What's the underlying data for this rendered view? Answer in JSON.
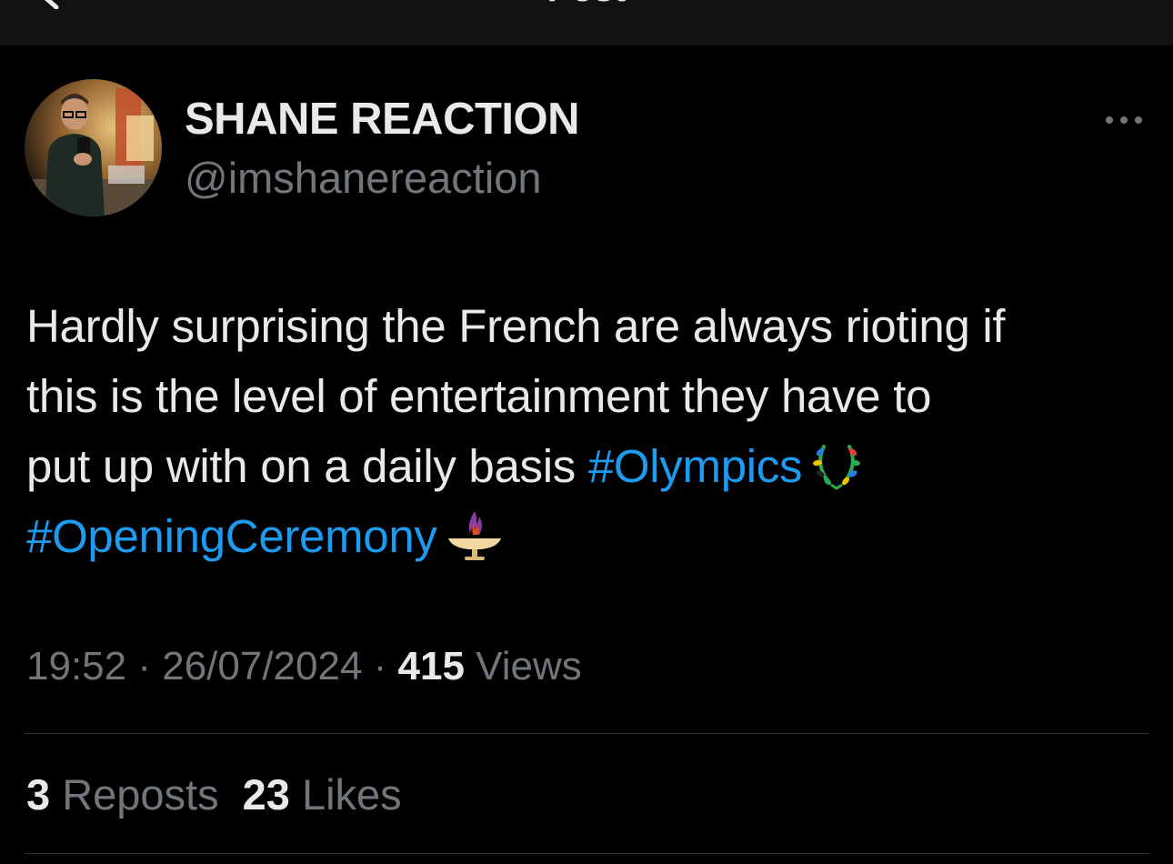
{
  "header": {
    "title": "Post",
    "back_icon": "arrow-left-icon"
  },
  "author": {
    "display_name": "SHANE REACTION",
    "handle": "@imshanereaction",
    "more_icon": "more-horizontal-icon"
  },
  "tweet": {
    "line1": "Hardly surprising the French are always rioting if",
    "line2": "this is the level of entertainment they have to",
    "line3_text": "put up with on a daily basis ",
    "hashtag1": "#Olympics",
    "emoji1": "laurel-wreath-icon",
    "hashtag2": "#OpeningCeremony",
    "emoji2": "olympic-cauldron-icon"
  },
  "meta": {
    "time": "19:52",
    "sep1": " · ",
    "date": "26/07/2024",
    "sep2": " · ",
    "views_count": "415",
    "views_label": " Views"
  },
  "stats": {
    "reposts_count": "3",
    "reposts_label": " Reposts",
    "likes_count": "23",
    "likes_label": " Likes"
  },
  "colors": {
    "background": "#000000",
    "header_bg": "#121212",
    "text": "#e7e9ea",
    "secondary": "#71767b",
    "link": "#1d9bf0",
    "divider": "#2f3336"
  }
}
